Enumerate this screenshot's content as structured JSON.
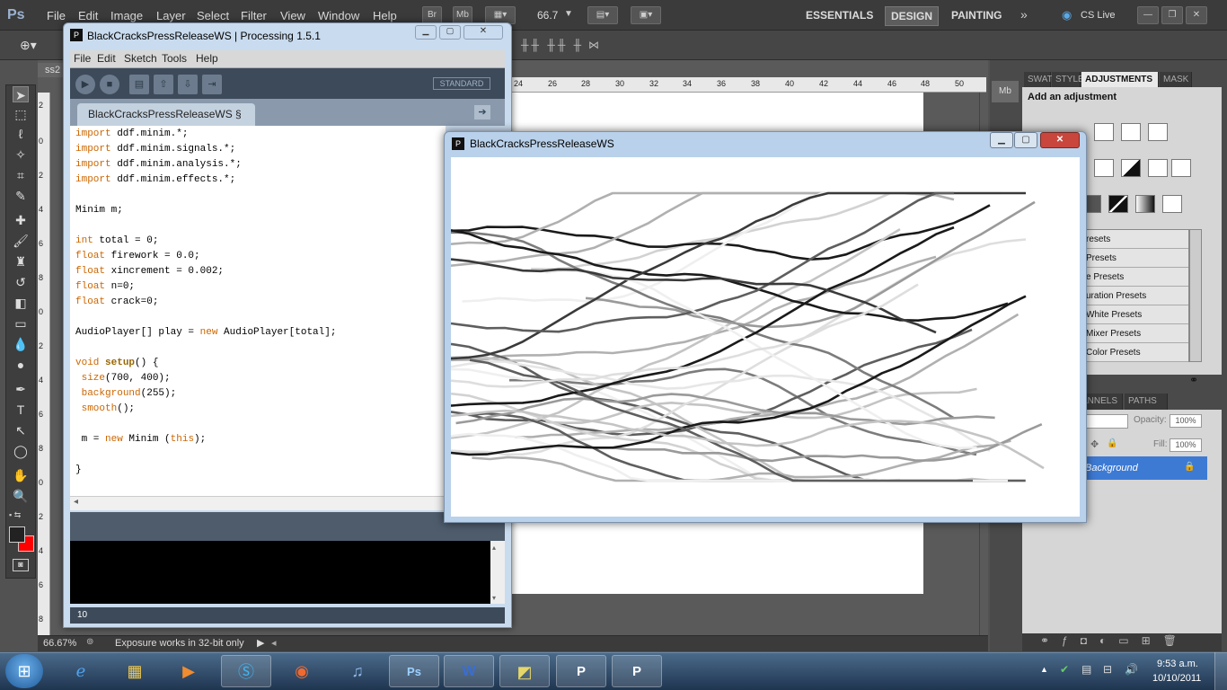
{
  "photoshop": {
    "logo": "Ps",
    "menus": [
      "File",
      "Edit",
      "Image",
      "Layer",
      "Select",
      "Filter",
      "View",
      "Window",
      "Help"
    ],
    "bridge_label": "Br",
    "minibridge_label": "Mb",
    "zoom": "66.7",
    "workspaces": [
      "ESSENTIALS",
      "DESIGN",
      "PAINTING"
    ],
    "active_workspace": "DESIGN",
    "cslive": "CS Live",
    "doc_tab": "ss2",
    "ruler_top": [
      "24",
      "26",
      "28",
      "30",
      "32",
      "34",
      "36",
      "38",
      "40",
      "42",
      "44",
      "46",
      "48",
      "50"
    ],
    "ruler_left": [
      "2",
      "0",
      "2",
      "4",
      "6",
      "8",
      "0",
      "2",
      "4",
      "6",
      "8",
      "0",
      "2",
      "4",
      "6",
      "8"
    ],
    "status_zoom": "66.67%",
    "status_message": "Exposure works in 32-bit only",
    "panel_tabs": [
      "SWAT",
      "STYLE",
      "ADJUSTMENTS",
      "MASK"
    ],
    "adjustments_heading": "Add an adjustment",
    "presets": [
      "resets",
      "Presets",
      "e Presets",
      "uration Presets",
      "White Presets",
      "Mixer Presets",
      "Color Presets"
    ],
    "layer_tabs": [
      "ANNELS",
      "PATHS"
    ],
    "opacity_label": "Opacity:",
    "opacity_value": "100%",
    "fill_label": "Fill:",
    "fill_value": "100%",
    "layer_name": "Background",
    "colors": {
      "foreground": "#222222",
      "background": "#ff0000",
      "selection": "#3d7ad4"
    }
  },
  "ide": {
    "title": "BlackCracksPressReleaseWS | Processing 1.5.1",
    "menus": [
      "File",
      "Edit",
      "Sketch",
      "Tools",
      "Help"
    ],
    "mode": "STANDARD",
    "tab_name": "BlackCracksPressReleaseWS §",
    "code_lines": [
      [
        {
          "t": "import",
          "c": "kw"
        },
        {
          "t": " ddf.minim.*;",
          "c": ""
        }
      ],
      [
        {
          "t": "import",
          "c": "kw"
        },
        {
          "t": " ddf.minim.signals.*;",
          "c": ""
        }
      ],
      [
        {
          "t": "import",
          "c": "kw"
        },
        {
          "t": " ddf.minim.analysis.*;",
          "c": ""
        }
      ],
      [
        {
          "t": "import",
          "c": "kw"
        },
        {
          "t": " ddf.minim.effects.*;",
          "c": ""
        }
      ],
      [
        {
          "t": "",
          "c": ""
        }
      ],
      [
        {
          "t": "Minim m;",
          "c": ""
        }
      ],
      [
        {
          "t": "",
          "c": ""
        }
      ],
      [
        {
          "t": "int",
          "c": "kw"
        },
        {
          "t": " total = 0;",
          "c": ""
        }
      ],
      [
        {
          "t": "float",
          "c": "kw"
        },
        {
          "t": " firework = 0.0;",
          "c": ""
        }
      ],
      [
        {
          "t": "float",
          "c": "kw"
        },
        {
          "t": " xincrement = 0.002;",
          "c": ""
        }
      ],
      [
        {
          "t": "float",
          "c": "kw"
        },
        {
          "t": " n=0;",
          "c": ""
        }
      ],
      [
        {
          "t": "float",
          "c": "kw"
        },
        {
          "t": " crack=0;",
          "c": ""
        }
      ],
      [
        {
          "t": "",
          "c": ""
        }
      ],
      [
        {
          "t": "AudioPlayer[] play = ",
          "c": ""
        },
        {
          "t": "new",
          "c": "kw"
        },
        {
          "t": " AudioPlayer[total];",
          "c": ""
        }
      ],
      [
        {
          "t": "",
          "c": ""
        }
      ],
      [
        {
          "t": "void",
          "c": "kw"
        },
        {
          "t": " ",
          "c": ""
        },
        {
          "t": "setup",
          "c": "fn"
        },
        {
          "t": "() {",
          "c": ""
        }
      ],
      [
        {
          "t": " ",
          "c": ""
        },
        {
          "t": "size",
          "c": "kw"
        },
        {
          "t": "(700, 400);",
          "c": ""
        }
      ],
      [
        {
          "t": " ",
          "c": ""
        },
        {
          "t": "background",
          "c": "kw"
        },
        {
          "t": "(255);",
          "c": ""
        }
      ],
      [
        {
          "t": " ",
          "c": ""
        },
        {
          "t": "smooth",
          "c": "kw"
        },
        {
          "t": "();",
          "c": ""
        }
      ],
      [
        {
          "t": "",
          "c": ""
        }
      ],
      [
        {
          "t": " m = ",
          "c": ""
        },
        {
          "t": "new",
          "c": "kw"
        },
        {
          "t": " Minim (",
          "c": ""
        },
        {
          "t": "this",
          "c": "kw"
        },
        {
          "t": ");",
          "c": ""
        }
      ],
      [
        {
          "t": "",
          "c": ""
        }
      ],
      [
        {
          "t": "}",
          "c": ""
        }
      ]
    ],
    "line_number": "10"
  },
  "sketch": {
    "title": "BlackCracksPressReleaseWS"
  },
  "taskbar": {
    "apps": [
      "IE",
      "Explorer",
      "Media Player",
      "Skype",
      "Firefox",
      "iTunes",
      "Ps",
      "Word",
      "Folder",
      "Processing",
      "Processing"
    ],
    "time": "9:53 a.m.",
    "date": "10/10/2011"
  }
}
